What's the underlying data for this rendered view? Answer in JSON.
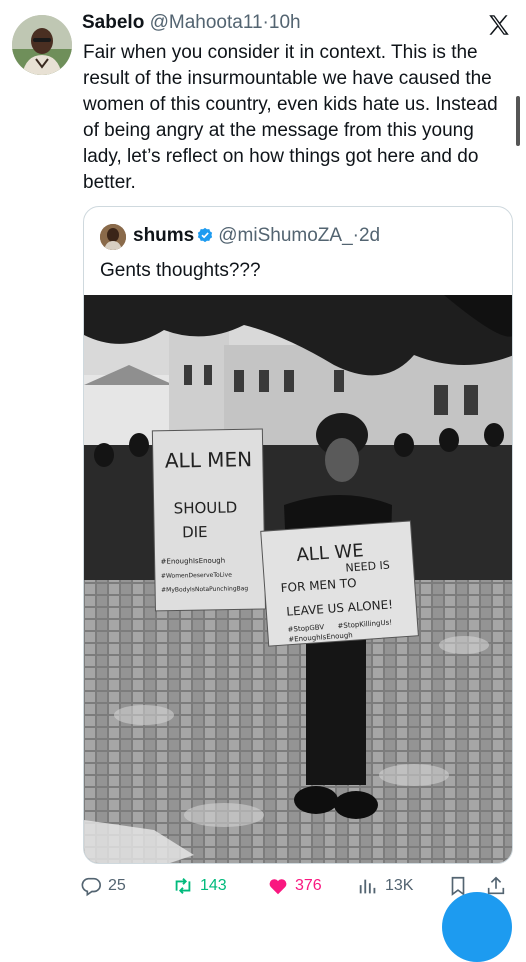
{
  "tweet": {
    "author_name": "Sabelo",
    "author_handle": "@Mahoota11",
    "separator": "·",
    "time": "10h",
    "text": "Fair when you consider it in context. This is the result of the insurmountable we have caused the women of this country, even kids hate us. Instead of being angry at the message from this young lady, let’s reflect on how things got here and do better."
  },
  "quoted_tweet": {
    "author_name": "shums",
    "author_handle": "@miShumoZA_",
    "separator": "·",
    "time": "2d",
    "text": "Gents thoughts???",
    "photo": {
      "sign_left": [
        "ALL MEN",
        "SHOULD",
        "DIE",
        "#EnoughIsEnough",
        "#WomenDeserveToLive",
        "#MyBodyIsNotaPunchingBag"
      ],
      "sign_right": [
        "ALL WE",
        "NEED IS",
        "FOR MEN TO",
        "LEAVE US ALONE!",
        "#StopGBV",
        "#StopKillingUs!",
        "#EnoughIsEnough"
      ]
    }
  },
  "actions": {
    "replies": "25",
    "retweets": "143",
    "likes": "376",
    "views": "13K"
  },
  "colors": {
    "retweet": "#00ba7c",
    "like": "#f91880",
    "accent": "#1d9bf0",
    "muted": "#536471"
  },
  "icons": [
    "x-logo-icon",
    "verified-badge-icon",
    "reply-icon",
    "retweet-icon",
    "like-icon",
    "views-icon",
    "bookmark-icon",
    "share-icon"
  ]
}
